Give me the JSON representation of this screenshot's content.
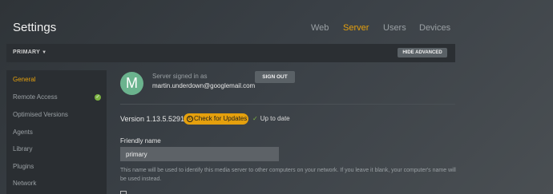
{
  "header": {
    "title": "Settings",
    "nav": [
      "Web",
      "Server",
      "Users",
      "Devices"
    ],
    "active_nav": "Server"
  },
  "subbar": {
    "server_name": "PRIMARY",
    "hide_advanced": "HIDE ADVANCED"
  },
  "sidebar": {
    "items": [
      {
        "label": "General",
        "active": true
      },
      {
        "label": "Remote Access",
        "status": "check"
      },
      {
        "label": "Optimised Versions"
      },
      {
        "label": "Agents"
      },
      {
        "label": "Library"
      },
      {
        "label": "Plugins"
      },
      {
        "label": "Network"
      }
    ]
  },
  "account": {
    "avatar_letter": "M",
    "signed_in_label": "Server signed in as",
    "email": "martin.underdown@googlemail.com",
    "sign_out": "SIGN OUT"
  },
  "version": {
    "text": "Version 1.13.5.5291",
    "check_updates": "Check for Updates",
    "status": "Up to date"
  },
  "friendly_name": {
    "label": "Friendly name",
    "value": "primary",
    "help": "This name will be used to identify this media server to other computers on your network. If you leave it blank, your computer's name will be used instead."
  },
  "colors": {
    "accent": "#e5a00d",
    "success": "#7cb342"
  }
}
